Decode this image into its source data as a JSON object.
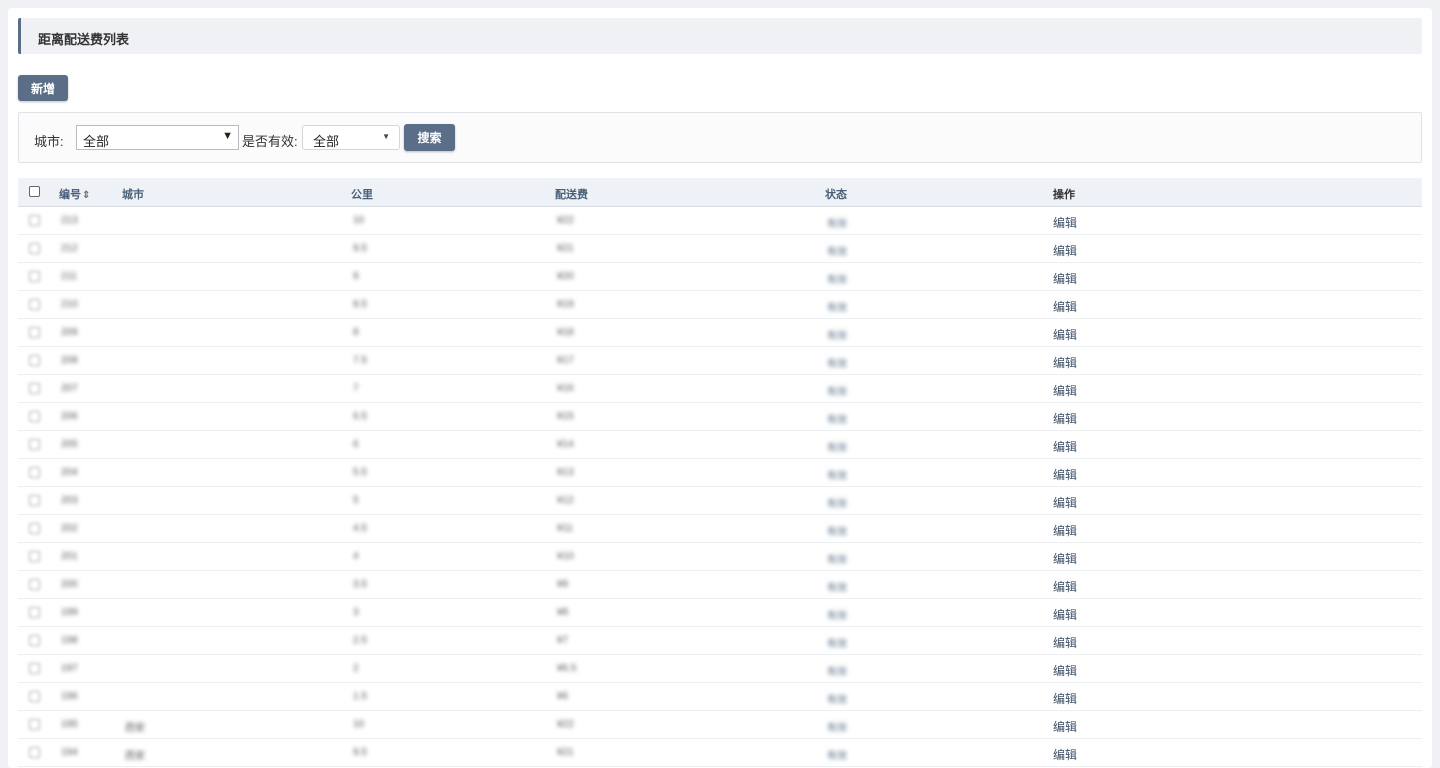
{
  "page": {
    "title": "距离配送费列表"
  },
  "toolbar": {
    "add_label": "新增"
  },
  "filters": {
    "city_label": "城市:",
    "city_value": "全部",
    "valid_label": "是否有效:",
    "valid_value": "全部",
    "search_label": "搜索"
  },
  "table": {
    "columns": {
      "id": "编号",
      "city": "城市",
      "km": "公里",
      "fee": "配送费",
      "status": "状态",
      "action": "操作"
    },
    "action_label": "编辑",
    "rows": [
      {
        "id": "213",
        "city": "",
        "km": "10",
        "fee": "¥22",
        "status": "有效"
      },
      {
        "id": "212",
        "city": "",
        "km": "9.5",
        "fee": "¥21",
        "status": "有效"
      },
      {
        "id": "211",
        "city": "",
        "km": "9",
        "fee": "¥20",
        "status": "有效"
      },
      {
        "id": "210",
        "city": "",
        "km": "8.5",
        "fee": "¥19",
        "status": "有效"
      },
      {
        "id": "209",
        "city": "",
        "km": "8",
        "fee": "¥18",
        "status": "有效"
      },
      {
        "id": "208",
        "city": "",
        "km": "7.5",
        "fee": "¥17",
        "status": "有效"
      },
      {
        "id": "207",
        "city": "",
        "km": "7",
        "fee": "¥16",
        "status": "有效"
      },
      {
        "id": "206",
        "city": "",
        "km": "6.5",
        "fee": "¥15",
        "status": "有效"
      },
      {
        "id": "205",
        "city": "",
        "km": "6",
        "fee": "¥14",
        "status": "有效"
      },
      {
        "id": "204",
        "city": "",
        "km": "5.5",
        "fee": "¥13",
        "status": "有效"
      },
      {
        "id": "203",
        "city": "",
        "km": "5",
        "fee": "¥12",
        "status": "有效"
      },
      {
        "id": "202",
        "city": "",
        "km": "4.5",
        "fee": "¥11",
        "status": "有效"
      },
      {
        "id": "201",
        "city": "",
        "km": "4",
        "fee": "¥10",
        "status": "有效"
      },
      {
        "id": "200",
        "city": "",
        "km": "3.5",
        "fee": "¥9",
        "status": "有效"
      },
      {
        "id": "199",
        "city": "",
        "km": "3",
        "fee": "¥8",
        "status": "有效"
      },
      {
        "id": "198",
        "city": "",
        "km": "2.5",
        "fee": "¥7",
        "status": "有效"
      },
      {
        "id": "197",
        "city": "",
        "km": "2",
        "fee": "¥6.5",
        "status": "有效"
      },
      {
        "id": "196",
        "city": "",
        "km": "1.5",
        "fee": "¥6",
        "status": "有效"
      },
      {
        "id": "195",
        "city": "西安",
        "km": "10",
        "fee": "¥22",
        "status": "有效"
      },
      {
        "id": "194",
        "city": "西安",
        "km": "9.5",
        "fee": "¥21",
        "status": "有效"
      }
    ]
  }
}
